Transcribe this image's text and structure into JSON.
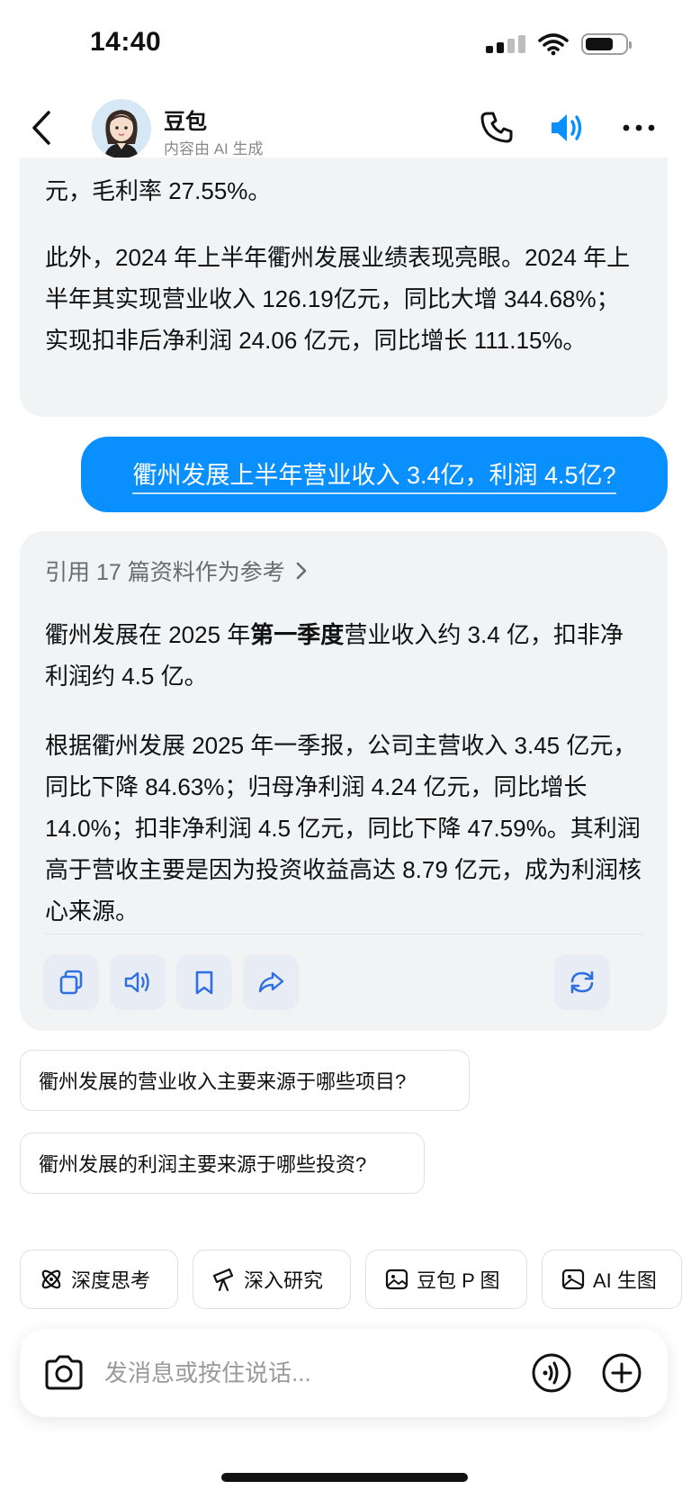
{
  "status_bar": {
    "time": "14:40"
  },
  "header": {
    "name": "豆包",
    "subtitle": "内容由 AI 生成"
  },
  "messages": {
    "ai_prev": {
      "line1": "元，毛利率 27.55%。",
      "paragraph": "此外，2024 年上半年衢州发展业绩表现亮眼。2024 年上半年其实现营业收入 126.19亿元，同比大增 344.68%；实现扣非后净利润 24.06 亿元，同比增长 111.15%。"
    },
    "user": {
      "text": "衢州发展上半年营业收入 3.4亿，利润 4.5亿?"
    },
    "ai_reply": {
      "reference_label": "引用 17 篇资料作为参考",
      "p1_a": "衢州发展在 2025 年",
      "p1_bold": "第一季度",
      "p1_b": "营业收入约 3.4 亿，扣非净利润约 4.5 亿。",
      "p2": "根据衢州发展 2025 年一季报，公司主营收入 3.45 亿元，同比下降 84.63%；归母净利润 4.24 亿元，同比增长 14.0%；扣非净利润 4.5 亿元，同比下降 47.59%。其利润高于营收主要是因为投资收益高达 8.79 亿元，成为利润核心来源。"
    }
  },
  "suggestions": [
    "衢州发展的营业收入主要来源于哪些项目?",
    "衢州发展的利润主要来源于哪些投资?"
  ],
  "tools": [
    {
      "label": "深度思考",
      "icon": "atom-icon"
    },
    {
      "label": "深入研究",
      "icon": "telescope-icon"
    },
    {
      "label": "豆包 P 图",
      "icon": "image-edit-icon"
    },
    {
      "label": "AI 生图",
      "icon": "image-icon"
    }
  ],
  "input": {
    "placeholder": "发消息或按住说话..."
  },
  "colors": {
    "accent": "#0a8fff",
    "bubble": "#f2f3f5"
  }
}
